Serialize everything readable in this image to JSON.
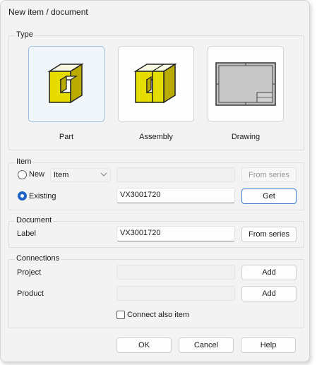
{
  "window": {
    "title": "New item / document"
  },
  "type_group": {
    "title": "Type",
    "tiles": [
      {
        "label": "Part",
        "icon": "part-icon",
        "selected": true
      },
      {
        "label": "Assembly",
        "icon": "assembly-icon",
        "selected": false
      },
      {
        "label": "Drawing",
        "icon": "drawing-icon",
        "selected": false
      }
    ]
  },
  "item_group": {
    "title": "Item",
    "new_label": "New",
    "new_type_value": "Item",
    "new_field_value": "",
    "from_series_label": "From series",
    "existing_label": "Existing",
    "existing_value": "VX3001720",
    "get_label": "Get",
    "selected_option": "Existing"
  },
  "document_group": {
    "title": "Document",
    "label_label": "Label",
    "label_value": "VX3001720",
    "from_series_label": "From series"
  },
  "connections_group": {
    "title": "Connections",
    "project_label": "Project",
    "project_value": "",
    "project_add": "Add",
    "product_label": "Product",
    "product_value": "",
    "product_add": "Add",
    "connect_also_label": "Connect also item",
    "connect_also_checked": false
  },
  "footer": {
    "ok": "OK",
    "cancel": "Cancel",
    "help": "Help"
  },
  "colors": {
    "icon_yellow": "#e6dc00",
    "accent_blue": "#1f63c6",
    "selected_tile_border": "#98bbe0"
  }
}
